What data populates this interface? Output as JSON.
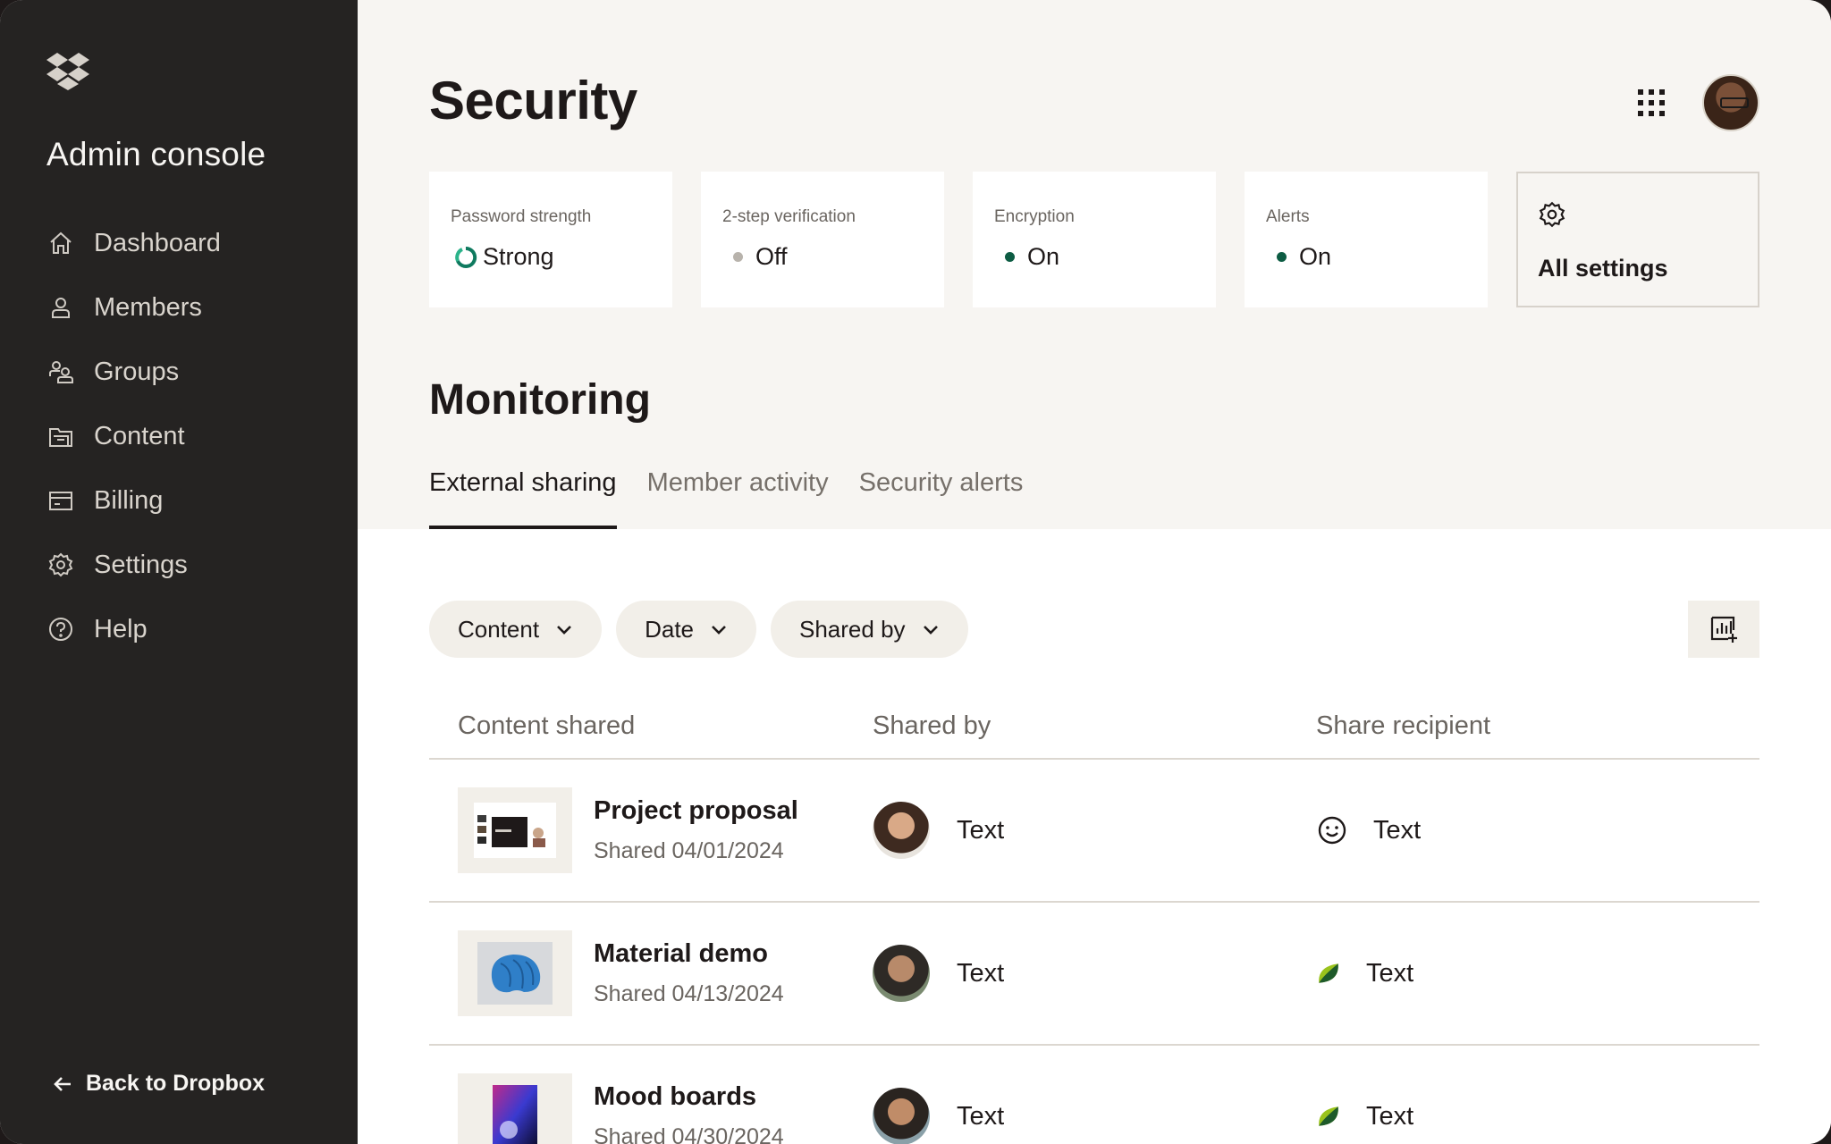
{
  "sidebar": {
    "title": "Admin console",
    "items": [
      {
        "label": "Dashboard",
        "icon": "home-icon"
      },
      {
        "label": "Members",
        "icon": "person-icon"
      },
      {
        "label": "Groups",
        "icon": "group-icon"
      },
      {
        "label": "Content",
        "icon": "folder-icon"
      },
      {
        "label": "Billing",
        "icon": "billing-icon"
      },
      {
        "label": "Settings",
        "icon": "gear-icon"
      },
      {
        "label": "Help",
        "icon": "help-icon"
      }
    ],
    "back_label": "Back to Dropbox"
  },
  "header": {
    "title": "Security"
  },
  "status_cards": [
    {
      "label": "Password strength",
      "value": "Strong",
      "indicator": "spinner",
      "color": "#0f7a5f"
    },
    {
      "label": "2-step verification",
      "value": "Off",
      "indicator": "dot",
      "color": "#b8b3ac"
    },
    {
      "label": "Encryption",
      "value": "On",
      "indicator": "dot",
      "color": "#0d5c43"
    },
    {
      "label": "Alerts",
      "value": "On",
      "indicator": "dot",
      "color": "#0d5c43"
    }
  ],
  "settings_card": {
    "label": "All settings",
    "icon": "gear-icon"
  },
  "monitoring": {
    "title": "Monitoring",
    "tabs": [
      {
        "label": "External sharing",
        "active": true
      },
      {
        "label": "Member activity",
        "active": false
      },
      {
        "label": "Security alerts",
        "active": false
      }
    ]
  },
  "filters": [
    {
      "label": "Content"
    },
    {
      "label": "Date"
    },
    {
      "label": "Shared by"
    }
  ],
  "table": {
    "columns": [
      "Content shared",
      "Shared by",
      "Share recipient"
    ],
    "rows": [
      {
        "name": "Project proposal",
        "date": "Shared 04/01/2024",
        "shared_by": "Text",
        "recipient": "Text",
        "recipient_icon": "smiley-icon"
      },
      {
        "name": "Material demo",
        "date": "Shared 04/13/2024",
        "shared_by": "Text",
        "recipient": "Text",
        "recipient_icon": "leaf-icon"
      },
      {
        "name": "Mood boards",
        "date": "Shared 04/30/2024",
        "shared_by": "Text",
        "recipient": "Text",
        "recipient_icon": "leaf-icon"
      }
    ]
  },
  "colors": {
    "sidebar_bg": "#252322",
    "page_bg": "#f7f5f2",
    "chip_bg": "#f2efe9",
    "accent_green": "#0d5c43",
    "leaf_green": "#9ac31c"
  }
}
